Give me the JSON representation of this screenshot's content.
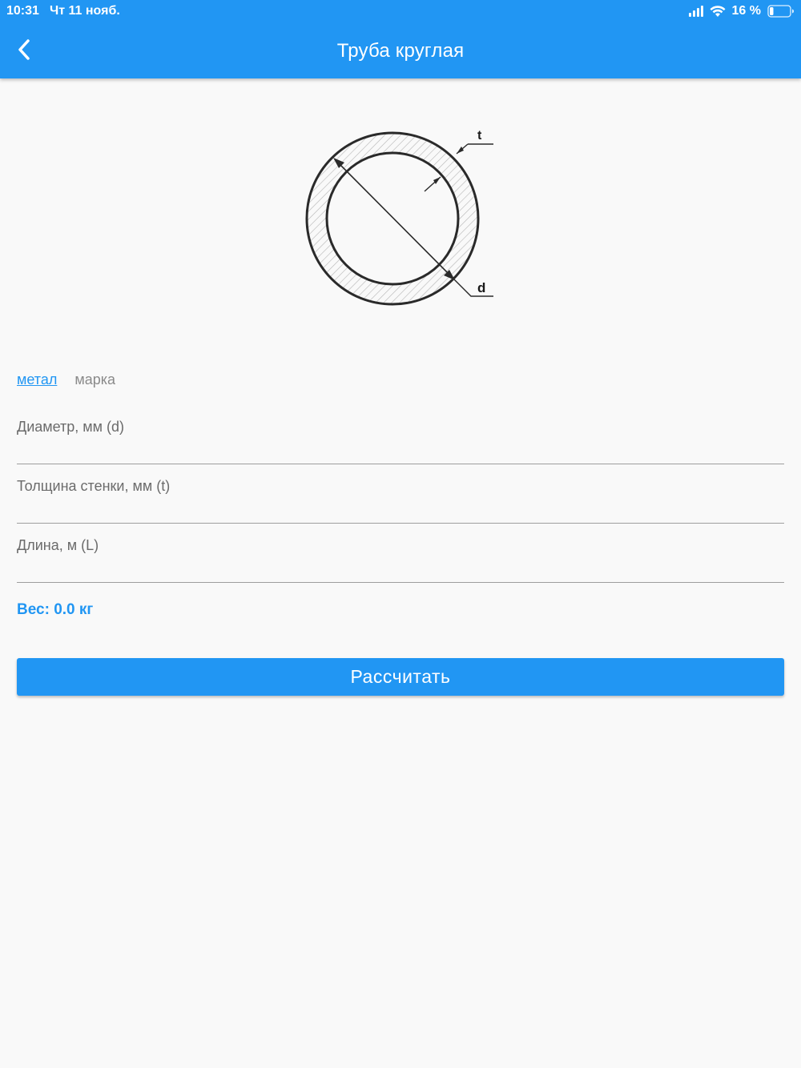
{
  "status_bar": {
    "time": "10:31",
    "date": "Чт 11 нояб.",
    "battery": "16 %",
    "signal_icon": "cellular-signal-icon",
    "wifi_icon": "wifi-icon",
    "battery_icon": "battery-icon"
  },
  "app_bar": {
    "back_icon": "chevron-left-icon",
    "title": "Труба круглая",
    "background_color": "#2196f3"
  },
  "diagram": {
    "label_t": "t",
    "label_d": "d"
  },
  "tabs": {
    "metal": "метал",
    "grade": "марка"
  },
  "form": {
    "diameter_placeholder": "Диаметр, мм (d)",
    "thickness_placeholder": "Толщина стенки, мм (t)",
    "length_placeholder": "Длина, м (L)",
    "diameter_value": "",
    "thickness_value": "",
    "length_value": ""
  },
  "result": {
    "weight_text": "Вес: 0.0 кг"
  },
  "actions": {
    "calculate_label": "Рассчитать"
  },
  "colors": {
    "accent": "#2196f3",
    "background": "#f9f9f9"
  }
}
